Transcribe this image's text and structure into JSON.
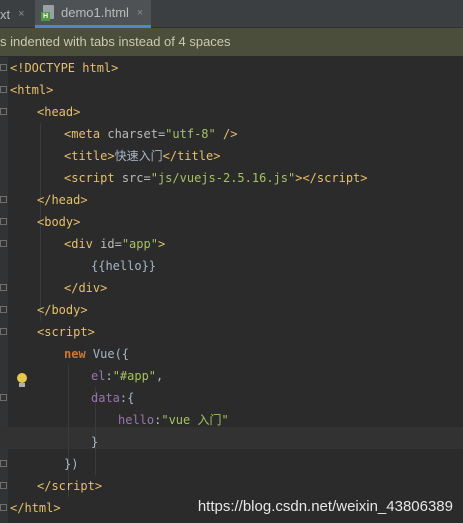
{
  "tabs": [
    {
      "label": "xt",
      "close": "×"
    },
    {
      "label": "demo1.html",
      "close": "×",
      "icon": "html-file-icon",
      "badge": "H"
    }
  ],
  "banner": {
    "text": "s indented with tabs instead of 4 spaces"
  },
  "code": {
    "l1": "<!DOCTYPE html>",
    "l2_o": "<",
    "l2_t": "html",
    "l2_c": ">",
    "l3_o": "<",
    "l3_t": "head",
    "l3_c": ">",
    "l4_o": "<",
    "l4_t": "meta ",
    "l4_a": "charset",
    "l4_eq": "=",
    "l4_v": "\"utf-8\"",
    "l4_c": " />",
    "l5_o": "<",
    "l5_t": "title",
    "l5_c1": ">",
    "l5_txt": "快速入门",
    "l5_c2": "</",
    "l5_t2": "title",
    "l5_c3": ">",
    "l6_o": "<",
    "l6_t": "script ",
    "l6_a": "src",
    "l6_eq": "=",
    "l6_v": "\"js/vuejs-2.5.16.js\"",
    "l6_c1": "></",
    "l6_t2": "script",
    "l6_c2": ">",
    "l7_o": "</",
    "l7_t": "head",
    "l7_c": ">",
    "l8_o": "<",
    "l8_t": "body",
    "l8_c": ">",
    "l9_o": "<",
    "l9_t": "div ",
    "l9_a": "id",
    "l9_eq": "=",
    "l9_v": "\"app\"",
    "l9_c": ">",
    "l10": "{{hello}}",
    "l11_o": "</",
    "l11_t": "div",
    "l11_c": ">",
    "l12_o": "</",
    "l12_t": "body",
    "l12_c": ">",
    "l13_o": "<",
    "l13_t": "script",
    "l13_c": ">",
    "l14_kw": "new ",
    "l14_txt": "Vue({",
    "l15_p": "el",
    "l15_c": ":",
    "l15_s": "\"#app\"",
    "l15_e": ",",
    "l16_p": "data",
    "l16_c": ":{",
    "l17_p": "hello",
    "l17_c": ":",
    "l17_s": "\"vue 入门\"",
    "l18": "}",
    "l19": "})",
    "l20_o": "</",
    "l20_t": "script",
    "l20_c": ">",
    "l21_o": "</",
    "l21_t": "html",
    "l21_c": ">"
  },
  "watermark": "https://blog.csdn.net/weixin_43806389",
  "colors": {
    "background": "#2b2b2b",
    "tag": "#e8bf6a",
    "string": "#a5c261",
    "keyword": "#cc7832",
    "property": "#9876aa"
  }
}
